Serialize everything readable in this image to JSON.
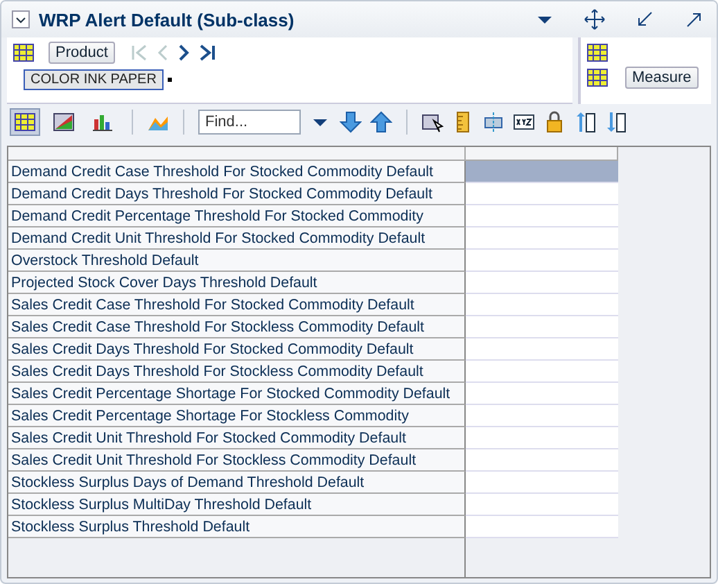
{
  "panel": {
    "title": "WRP Alert Default (Sub-class)"
  },
  "pivot": {
    "row_dimension": "Product",
    "filter_tag": "COLOR INK PAPER",
    "column_dimension": "Measure"
  },
  "toolbar": {
    "view_buttons": [
      {
        "kind": "grid",
        "selected": true
      },
      {
        "kind": "chart",
        "selected": false
      },
      {
        "kind": "bar",
        "selected": false
      }
    ],
    "find": {
      "placeholder": "Find..."
    }
  },
  "table": {
    "rows": [
      {
        "label": "Demand Credit Case Threshold For Stocked Commodity Default",
        "selected": true
      },
      {
        "label": "Demand Credit Days Threshold For Stocked Commodity Default",
        "selected": false
      },
      {
        "label": "Demand Credit Percentage Threshold For Stocked Commodity",
        "selected": false
      },
      {
        "label": "Demand Credit Unit Threshold For Stocked Commodity Default",
        "selected": false
      },
      {
        "label": "Overstock Threshold Default",
        "selected": false
      },
      {
        "label": "Projected Stock Cover Days Threshold Default",
        "selected": false
      },
      {
        "label": "Sales Credit Case Threshold For Stocked Commodity Default",
        "selected": false
      },
      {
        "label": "Sales Credit Case Threshold For Stockless Commodity Default",
        "selected": false
      },
      {
        "label": "Sales Credit Days Threshold For Stocked Commodity Default",
        "selected": false
      },
      {
        "label": "Sales Credit Days Threshold For Stockless Commodity Default",
        "selected": false
      },
      {
        "label": "Sales Credit Percentage Shortage For Stocked Commodity Default",
        "selected": false
      },
      {
        "label": "Sales Credit Percentage Shortage For Stockless Commodity",
        "selected": false
      },
      {
        "label": "Sales Credit Unit Threshold For Stocked Commodity Default",
        "selected": false
      },
      {
        "label": "Sales Credit Unit Threshold For Stockless Commodity Default",
        "selected": false
      },
      {
        "label": "Stockless Surplus Days of Demand Threshold Default",
        "selected": false
      },
      {
        "label": "Stockless Surplus MultiDay Threshold Default",
        "selected": false
      },
      {
        "label": "Stockless Surplus Threshold Default",
        "selected": false
      }
    ]
  }
}
